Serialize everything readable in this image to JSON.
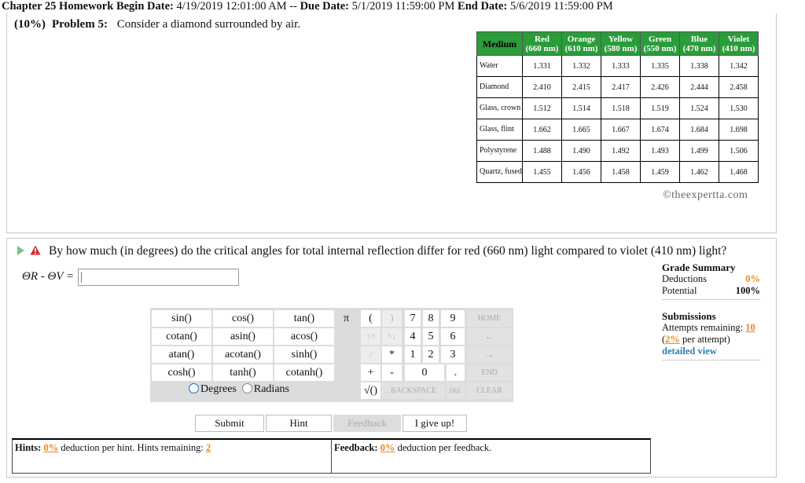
{
  "header": {
    "chapter": "Chapter 25 Homework",
    "begin_label": "Begin Date:",
    "begin_date": "4/19/2019 12:01:00 AM",
    "sep": "--",
    "due_label": "Due Date:",
    "due_date": "5/1/2019 11:59:00 PM",
    "end_label": "End Date:",
    "end_date": "5/6/2019 11:59:00 PM"
  },
  "problem": {
    "weight": "(10%)",
    "label": "Problem 5:",
    "text": "Consider a diamond surrounded by air."
  },
  "table": {
    "medium_header": "Medium",
    "columns": [
      {
        "color": "Red",
        "wavelength": "(660 nm)"
      },
      {
        "color": "Orange",
        "wavelength": "(610 nm)"
      },
      {
        "color": "Yellow",
        "wavelength": "(580 nm)"
      },
      {
        "color": "Green",
        "wavelength": "(550 nm)"
      },
      {
        "color": "Blue",
        "wavelength": "(470 nm)"
      },
      {
        "color": "Violet",
        "wavelength": "(410 nm)"
      }
    ],
    "rows": [
      {
        "medium": "Water",
        "values": [
          "1.331",
          "1.332",
          "1.333",
          "1.335",
          "1.338",
          "1.342"
        ]
      },
      {
        "medium": "Diamond",
        "values": [
          "2.410",
          "2.415",
          "2.417",
          "2.426",
          "2.444",
          "2.458"
        ]
      },
      {
        "medium": "Glass, crown",
        "values": [
          "1.512",
          "1.514",
          "1.518",
          "1.519",
          "1.524",
          "1.530"
        ]
      },
      {
        "medium": "Glass, flint",
        "values": [
          "1.662",
          "1.665",
          "1.667",
          "1.674",
          "1.684",
          "1.698"
        ]
      },
      {
        "medium": "Polystyrene",
        "values": [
          "1.488",
          "1.490",
          "1.492",
          "1.493",
          "1.499",
          "1.506"
        ]
      },
      {
        "medium": "Quartz, fused",
        "values": [
          "1.455",
          "1.456",
          "1.458",
          "1.459",
          "1.462",
          "1.468"
        ]
      }
    ],
    "header_color": "#2b9c3a"
  },
  "copyright": "©theexpertta.com",
  "question": {
    "text": "By how much (in degrees) do the critical angles for total internal reflection differ for red (660 nm) light compared to violet (410 nm) light?",
    "answer_label": "ΘR - ΘV =",
    "answer_value": ""
  },
  "grade_summary": {
    "title": "Grade Summary",
    "deductions_label": "Deductions",
    "deductions_value": "0%",
    "potential_label": "Potential",
    "potential_value": "100%"
  },
  "submissions": {
    "title": "Submissions",
    "attempts_label": "Attempts remaining:",
    "attempts_value": "10",
    "per_attempt_pct": "2%",
    "per_attempt_label": "per attempt)",
    "detailed_view": "detailed view"
  },
  "calculator": {
    "functions": [
      [
        "sin()",
        "cos()",
        "tan()"
      ],
      [
        "cotan()",
        "asin()",
        "acos()"
      ],
      [
        "atan()",
        "acotan()",
        "sinh()"
      ],
      [
        "cosh()",
        "tanh()",
        "cotanh()"
      ]
    ],
    "degrees": "Degrees",
    "radians": "Radians",
    "pi": "π",
    "open_paren": "(",
    "close_paren": ")",
    "up_arrows": "↑^",
    "down_arrows": "^↓",
    "digits": [
      "7",
      "8",
      "9",
      "4",
      "5",
      "6",
      "1",
      "2",
      "3",
      "0"
    ],
    "home": "HOME",
    "left": "←",
    "right": "→",
    "end": "END",
    "divide": "/",
    "multiply": "*",
    "plus": "+",
    "minus": "-",
    "dot": ".",
    "sqrt": "√()",
    "backspace": "BACKSPACE",
    "del": "DEL",
    "clear": "CLEAR"
  },
  "actions": {
    "submit": "Submit",
    "hint": "Hint",
    "feedback": "Feedback",
    "give_up": "I give up!"
  },
  "hints": {
    "label": "Hints:",
    "pct": "0%",
    "text": "deduction per hint. Hints remaining:",
    "remaining": "2"
  },
  "feedback": {
    "label": "Feedback:",
    "pct": "0%",
    "text": "deduction per feedback."
  }
}
